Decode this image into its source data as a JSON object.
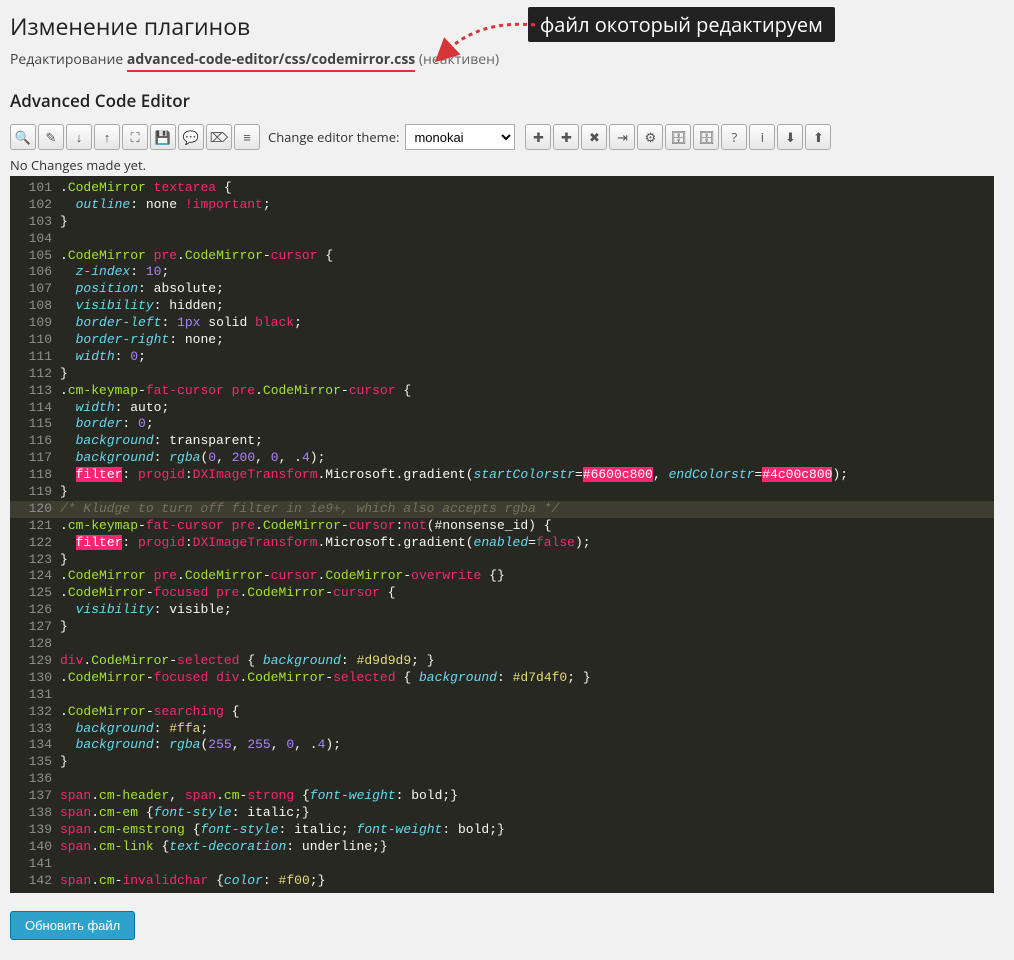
{
  "header": {
    "title": "Изменение плагинов",
    "edit_label": "Редактирование",
    "file_path": "advanced-code-editor/css/codemirror.css",
    "inactive_label": "(неактивен)",
    "callout_text": "файл окоторый редактируем"
  },
  "section_title": "Advanced Code Editor",
  "toolbar": {
    "theme_label": "Change editor theme:",
    "theme_selected": "monokai",
    "groups": [
      [
        "search-icon"
      ],
      [
        "replace-icon",
        "jump-down-icon",
        "jump-up-icon",
        "fullscreen-icon"
      ],
      [
        "save-icon",
        "comment-icon",
        "tag-icon",
        "list-icon"
      ]
    ],
    "groups_right": [
      [
        "new-file-icon",
        "new-folder-icon",
        "delete-icon",
        "indent-icon"
      ],
      [
        "settings-icon",
        "database-icon",
        "db2-icon",
        "help-icon"
      ],
      [
        "info-icon"
      ],
      [
        "download-icon",
        "upload-icon"
      ]
    ]
  },
  "status_text": "No Changes made yet.",
  "code_lines": [
    {
      "n": 101,
      "html": ".<span class='c-class'>CodeMirror</span> <span class='c-tag'>textarea</span> <span class='c-punct'>{</span>"
    },
    {
      "n": 102,
      "html": "  <span class='c-prop'>outline</span><span class='c-punct'>:</span> none <span class='c-tag'>!important</span><span class='c-punct'>;</span>"
    },
    {
      "n": 103,
      "html": "<span class='c-punct'>}</span>"
    },
    {
      "n": 104,
      "html": ""
    },
    {
      "n": 105,
      "html": ".<span class='c-class'>CodeMirror</span> <span class='c-tag'>pre</span>.<span class='c-class'>CodeMirror</span>-<span class='c-tag'>cursor</span> <span class='c-punct'>{</span>"
    },
    {
      "n": 106,
      "html": "  <span class='c-prop'>z-index</span><span class='c-punct'>:</span> <span class='c-num'>10</span><span class='c-punct'>;</span>"
    },
    {
      "n": 107,
      "html": "  <span class='c-prop'>position</span><span class='c-punct'>:</span> absolute<span class='c-punct'>;</span>"
    },
    {
      "n": 108,
      "html": "  <span class='c-prop'>visibility</span><span class='c-punct'>:</span> hidden<span class='c-punct'>;</span>"
    },
    {
      "n": 109,
      "html": "  <span class='c-prop'>border-left</span><span class='c-punct'>:</span> <span class='c-num'>1px</span> solid <span class='c-tag'>black</span><span class='c-punct'>;</span>"
    },
    {
      "n": 110,
      "html": "  <span class='c-prop'>border-right</span><span class='c-punct'>:</span> none<span class='c-punct'>;</span>"
    },
    {
      "n": 111,
      "html": "  <span class='c-prop'>width</span><span class='c-punct'>:</span> <span class='c-num'>0</span><span class='c-punct'>;</span>"
    },
    {
      "n": 112,
      "html": "<span class='c-punct'>}</span>"
    },
    {
      "n": 113,
      "html": ".<span class='c-class'>cm-keymap</span>-<span class='c-tag'>fat-cursor</span> <span class='c-tag'>pre</span>.<span class='c-class'>CodeMirror</span>-<span class='c-tag'>cursor</span> <span class='c-punct'>{</span>"
    },
    {
      "n": 114,
      "html": "  <span class='c-prop'>width</span><span class='c-punct'>:</span> auto<span class='c-punct'>;</span>"
    },
    {
      "n": 115,
      "html": "  <span class='c-prop'>border</span><span class='c-punct'>:</span> <span class='c-num'>0</span><span class='c-punct'>;</span>"
    },
    {
      "n": 116,
      "html": "  <span class='c-prop'>background</span><span class='c-punct'>:</span> transparent<span class='c-punct'>;</span>"
    },
    {
      "n": 117,
      "html": "  <span class='c-prop'>background</span><span class='c-punct'>:</span> <span class='c-prop'>rgba</span>(<span class='c-num'>0</span><span class='c-punct'>,</span> <span class='c-num'>200</span><span class='c-punct'>,</span> <span class='c-num'>0</span><span class='c-punct'>,</span> .<span class='c-num'>4</span>)<span class='c-punct'>;</span>"
    },
    {
      "n": 118,
      "html": "  <span class='c-err'>filter</span><span class='c-punct'>:</span> <span class='c-tag'>progid</span><span class='c-punct'>:</span><span class='c-tag'>DXImageTransform</span>.Microsoft.gradient(<span class='c-prop'>startColorstr</span>=<span class='c-err'>#6600c800</span><span class='c-punct'>,</span> <span class='c-prop'>endColorstr</span>=<span class='c-err'>#4c00c800</span>)<span class='c-punct'>;</span>"
    },
    {
      "n": 119,
      "html": "<span class='c-punct'>}</span>"
    },
    {
      "n": 120,
      "active": true,
      "html": "<span class='c-comment'>/* Kludge to turn off filter in ie9+, which also accepts rgba */</span>"
    },
    {
      "n": 121,
      "html": ".<span class='c-class'>cm-keymap</span>-<span class='c-tag'>fat-cursor</span> <span class='c-tag'>pre</span>.<span class='c-class'>CodeMirror</span>-<span class='c-tag'>cursor</span><span class='c-punct'>:</span><span class='c-tag'>not</span>(#nonsense_id) <span class='c-punct'>{</span>"
    },
    {
      "n": 122,
      "html": "  <span class='c-err'>filter</span><span class='c-punct'>:</span> <span class='c-tag'>progid</span><span class='c-punct'>:</span><span class='c-tag'>DXImageTransform</span>.Microsoft.gradient(<span class='c-prop'>enabled</span>=<span class='c-tag'>false</span>)<span class='c-punct'>;</span>"
    },
    {
      "n": 123,
      "html": "<span class='c-punct'>}</span>"
    },
    {
      "n": 124,
      "html": ".<span class='c-class'>CodeMirror</span> <span class='c-tag'>pre</span>.<span class='c-class'>CodeMirror</span>-<span class='c-tag'>cursor</span>.<span class='c-class'>CodeMirror</span>-<span class='c-tag'>overwrite</span> <span class='c-punct'>{}</span>"
    },
    {
      "n": 125,
      "html": ".<span class='c-class'>CodeMirror</span>-<span class='c-tag'>focused</span> <span class='c-tag'>pre</span>.<span class='c-class'>CodeMirror</span>-<span class='c-tag'>cursor</span> <span class='c-punct'>{</span>"
    },
    {
      "n": 126,
      "html": "  <span class='c-prop'>visibility</span><span class='c-punct'>:</span> visible<span class='c-punct'>;</span>"
    },
    {
      "n": 127,
      "html": "<span class='c-punct'>}</span>"
    },
    {
      "n": 128,
      "html": ""
    },
    {
      "n": 129,
      "html": "<span class='c-tag'>div</span>.<span class='c-class'>CodeMirror</span>-<span class='c-tag'>selected</span> <span class='c-punct'>{</span> <span class='c-prop'>background</span><span class='c-punct'>:</span> <span class='c-str'>#d9d9d9</span><span class='c-punct'>;</span> <span class='c-punct'>}</span>"
    },
    {
      "n": 130,
      "html": ".<span class='c-class'>CodeMirror</span>-<span class='c-tag'>focused</span> <span class='c-tag'>div</span>.<span class='c-class'>CodeMirror</span>-<span class='c-tag'>selected</span> <span class='c-punct'>{</span> <span class='c-prop'>background</span><span class='c-punct'>:</span> <span class='c-str'>#d7d4f0</span><span class='c-punct'>;</span> <span class='c-punct'>}</span>"
    },
    {
      "n": 131,
      "html": ""
    },
    {
      "n": 132,
      "html": ".<span class='c-class'>CodeMirror</span>-<span class='c-tag'>searching</span> <span class='c-punct'>{</span>"
    },
    {
      "n": 133,
      "html": "  <span class='c-prop'>background</span><span class='c-punct'>:</span> <span class='c-str'>#ffa</span><span class='c-punct'>;</span>"
    },
    {
      "n": 134,
      "html": "  <span class='c-prop'>background</span><span class='c-punct'>:</span> <span class='c-prop'>rgba</span>(<span class='c-num'>255</span><span class='c-punct'>,</span> <span class='c-num'>255</span><span class='c-punct'>,</span> <span class='c-num'>0</span><span class='c-punct'>,</span> .<span class='c-num'>4</span>)<span class='c-punct'>;</span>"
    },
    {
      "n": 135,
      "html": "<span class='c-punct'>}</span>"
    },
    {
      "n": 136,
      "html": ""
    },
    {
      "n": 137,
      "html": "<span class='c-tag'>span</span>.<span class='c-class'>cm-header</span><span class='c-punct'>,</span> <span class='c-tag'>span</span>.<span class='c-class'>cm</span>-<span class='c-tag'>strong</span> <span class='c-punct'>{</span><span class='c-prop'>font-weight</span><span class='c-punct'>:</span> bold<span class='c-punct'>;}</span>"
    },
    {
      "n": 138,
      "html": "<span class='c-tag'>span</span>.<span class='c-class'>cm-em</span> <span class='c-punct'>{</span><span class='c-prop'>font-style</span><span class='c-punct'>:</span> italic<span class='c-punct'>;}</span>"
    },
    {
      "n": 139,
      "html": "<span class='c-tag'>span</span>.<span class='c-class'>cm-emstrong</span> <span class='c-punct'>{</span><span class='c-prop'>font-style</span><span class='c-punct'>:</span> italic<span class='c-punct'>;</span> <span class='c-prop'>font-weight</span><span class='c-punct'>:</span> bold<span class='c-punct'>;}</span>"
    },
    {
      "n": 140,
      "html": "<span class='c-tag'>span</span>.<span class='c-class'>cm-link</span> <span class='c-punct'>{</span><span class='c-prop'>text-decoration</span><span class='c-punct'>:</span> underline<span class='c-punct'>;}</span>"
    },
    {
      "n": 141,
      "html": ""
    },
    {
      "n": 142,
      "html": "<span class='c-tag'>span</span>.<span class='c-class'>cm</span>-<span class='c-tag'>invalidchar</span> <span class='c-punct'>{</span><span class='c-prop'>color</span><span class='c-punct'>:</span> <span class='c-str'>#f00</span><span class='c-punct'>;}</span>"
    }
  ],
  "submit_label": "Обновить файл",
  "icons": {
    "search-icon": "🔍",
    "replace-icon": "✎",
    "jump-down-icon": "↓",
    "jump-up-icon": "↑",
    "fullscreen-icon": "⛶",
    "save-icon": "💾",
    "comment-icon": "💬",
    "tag-icon": "⌦",
    "list-icon": "≡",
    "new-file-icon": "✚",
    "new-folder-icon": "✚",
    "delete-icon": "✖",
    "indent-icon": "⇥",
    "settings-icon": "⚙",
    "database-icon": "🗄",
    "db2-icon": "🗄",
    "help-icon": "?",
    "info-icon": "i",
    "download-icon": "⬇",
    "upload-icon": "⬆"
  }
}
